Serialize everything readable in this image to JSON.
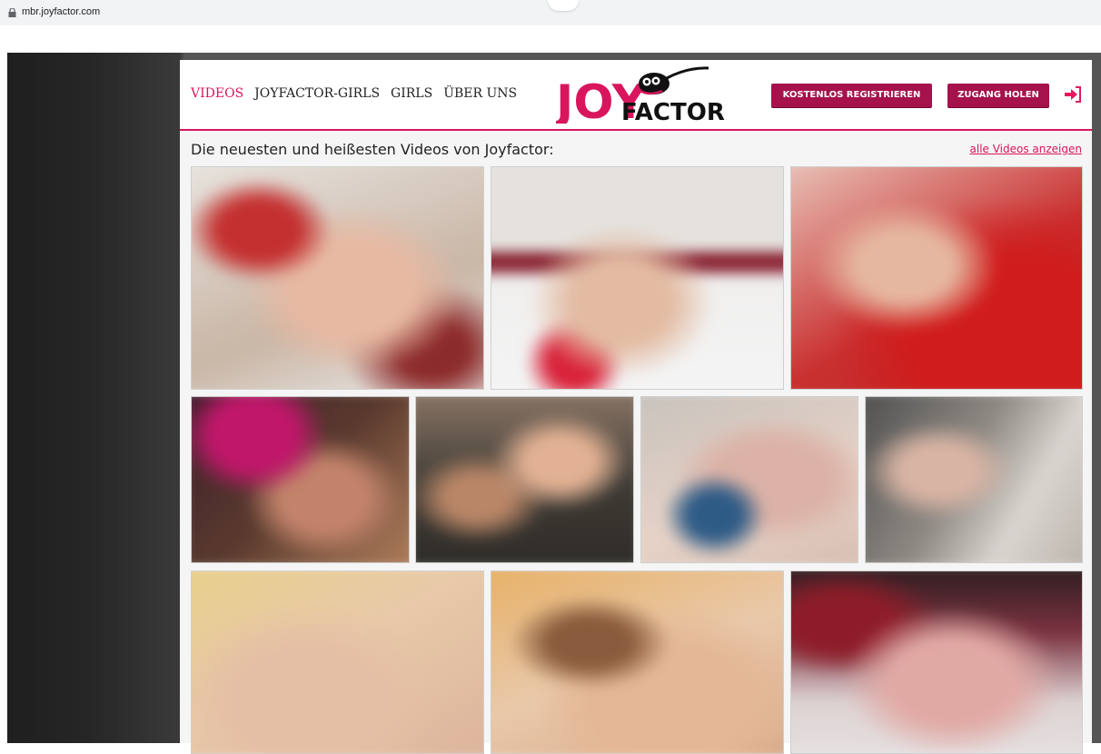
{
  "browser": {
    "url": "mbr.joyfactor.com"
  },
  "nav": {
    "videos": "VIDEOS",
    "joyfactor_girls": "JOYFACTOR-GIRLS",
    "girls": "GIRLS",
    "about": "ÜBER UNS"
  },
  "logo": {
    "part1": "JOY",
    "part2": "FACTOR"
  },
  "buttons": {
    "register": "KOSTENLOS REGISTRIEREN",
    "access": "ZUGANG HOLEN"
  },
  "section": {
    "title": "Die neuesten und heißesten Videos von Joyfactor:",
    "all_link": "alle Videos anzeigen"
  },
  "colors": {
    "accent": "#d9155d",
    "button": "#a5124c"
  },
  "thumbnails": [
    "blurred-video-thumbnail",
    "blurred-video-thumbnail",
    "blurred-video-thumbnail",
    "blurred-video-thumbnail",
    "blurred-video-thumbnail",
    "blurred-video-thumbnail",
    "blurred-video-thumbnail",
    "blurred-video-thumbnail",
    "blurred-video-thumbnail",
    "blurred-video-thumbnail"
  ]
}
